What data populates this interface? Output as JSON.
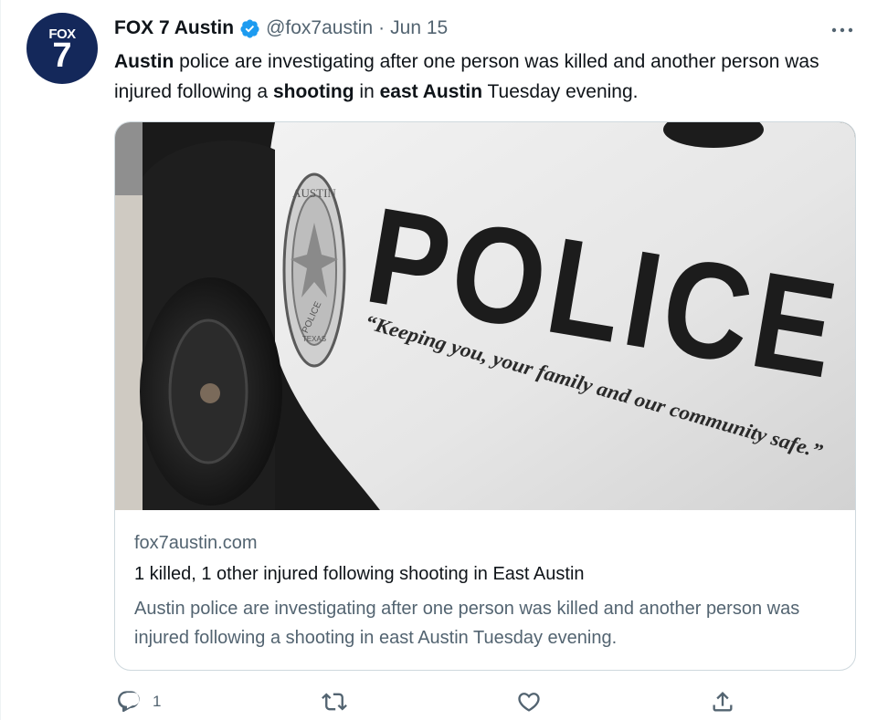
{
  "account": {
    "avatar_text_top": "FOX",
    "avatar_text_bottom": "7",
    "display_name": "FOX 7 Austin",
    "handle": "@fox7austin",
    "separator": "·",
    "date": "Jun 15",
    "verified": true
  },
  "tweet": {
    "segments": [
      {
        "text": "Austin",
        "bold": true
      },
      {
        "text": " police are investigating after one person was killed and another person was injured following a ",
        "bold": false
      },
      {
        "text": "shooting",
        "bold": true
      },
      {
        "text": " in ",
        "bold": false
      },
      {
        "text": "east Austin",
        "bold": true
      },
      {
        "text": " Tuesday evening.",
        "bold": false
      }
    ]
  },
  "card": {
    "image": {
      "badge_arc_text": "AUSTIN",
      "badge_ribbon_text": "POLICE",
      "badge_bottom_text": "TEXAS",
      "door_word": "POLICE",
      "motto": "“Keeping you, your family and our community safe.”"
    },
    "domain": "fox7austin.com",
    "title": "1 killed, 1 other injured following shooting in East Austin",
    "description": "Austin police are investigating after one person was killed and another person was injured following a shooting in east Austin Tuesday evening."
  },
  "actions": {
    "reply_count": "1"
  },
  "colors": {
    "text_primary": "#0f1419",
    "text_secondary": "#536471",
    "verified_badge": "#1d9bf0",
    "avatar_bg": "#14285a",
    "card_border": "#cfd9de"
  },
  "icons": [
    "verified-badge-icon",
    "more-options-icon",
    "reply-icon",
    "retweet-icon",
    "like-icon",
    "share-icon"
  ]
}
